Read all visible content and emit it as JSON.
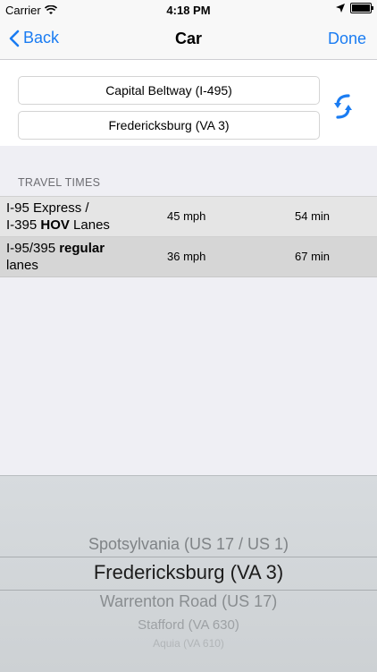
{
  "status_bar": {
    "carrier": "Carrier",
    "time": "4:18 PM"
  },
  "nav": {
    "back_label": "Back",
    "title": "Car",
    "done_label": "Done"
  },
  "route": {
    "from": "Capital Beltway (I-495)",
    "to": "Fredericksburg (VA 3)"
  },
  "travel_times": {
    "header": "TRAVEL TIMES",
    "rows": [
      {
        "route_line1": "I-95 Express /",
        "route_line2_prefix": "I-395 ",
        "route_line2_bold": "HOV",
        "route_line2_suffix": " Lanes",
        "speed": "45 mph",
        "time": "54 min"
      },
      {
        "route_line1_prefix": "I-95/395 ",
        "route_line1_bold": "regular",
        "route_line2": "lanes",
        "speed": "36 mph",
        "time": "67 min"
      }
    ]
  },
  "picker": {
    "above": "Spotsylvania (US 17 / US 1)",
    "selected": "Fredericksburg (VA 3)",
    "below1": "Warrenton Road (US 17)",
    "below2": "Stafford (VA 630)",
    "below3": "Aquia (VA 610)"
  },
  "colors": {
    "accent": "#1a7cf2",
    "row_alt": "#e5e5e5",
    "row_highlight": "#d6d6d6",
    "picker_bg": "#d3d7da"
  }
}
